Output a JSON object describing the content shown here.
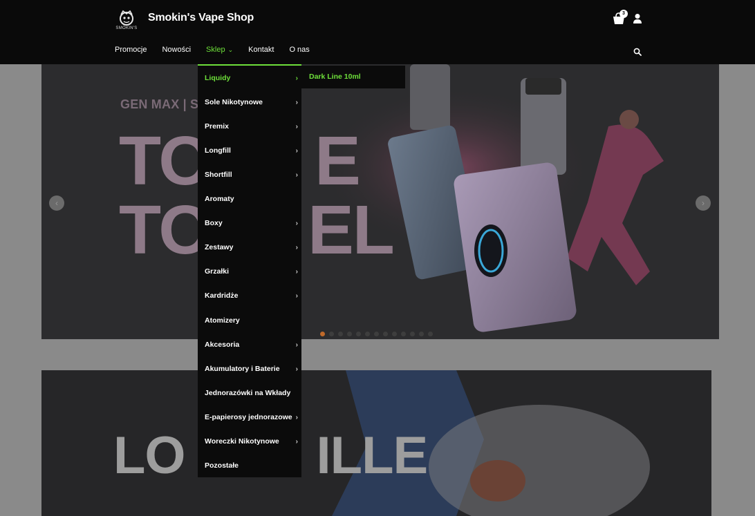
{
  "header": {
    "site_title": "Smokin's Vape Shop",
    "logo_text": "SMOKIN'S",
    "cart_count": "3"
  },
  "nav": {
    "items": [
      {
        "label": "Promocje"
      },
      {
        "label": "Nowości"
      },
      {
        "label": "Sklep"
      },
      {
        "label": "Kontakt"
      },
      {
        "label": "O nas"
      }
    ]
  },
  "dropdown": {
    "items": [
      {
        "label": "Liquidy"
      },
      {
        "label": "Sole Nikotynowe"
      },
      {
        "label": "Premix"
      },
      {
        "label": "Longfill"
      },
      {
        "label": "Shortfill"
      },
      {
        "label": "Aromaty"
      },
      {
        "label": "Boxy"
      },
      {
        "label": "Zestawy"
      },
      {
        "label": "Grzałki"
      },
      {
        "label": "Kardridże"
      },
      {
        "label": "Atomizery"
      },
      {
        "label": "Akcesoria"
      },
      {
        "label": "Akumulatory i Baterie"
      },
      {
        "label": "Jednorazówki na Wkłady"
      },
      {
        "label": "E-papierosy jednorazowe"
      },
      {
        "label": "Woreczki Nikotynowe"
      },
      {
        "label": "Pozostałe"
      }
    ],
    "submenu": {
      "label": "Dark Line 10ml"
    }
  },
  "hero": {
    "subtitle": "GEN MAX | SI",
    "line1": "TO",
    "line1b": "E",
    "line2": "TO",
    "line2b": "EL"
  },
  "banner2": {
    "text_left": "LO",
    "text_right": "ILLE"
  },
  "colors": {
    "accent": "#6ee03a",
    "header_bg": "#0a0a0a",
    "active_dot": "#c06a2a"
  }
}
